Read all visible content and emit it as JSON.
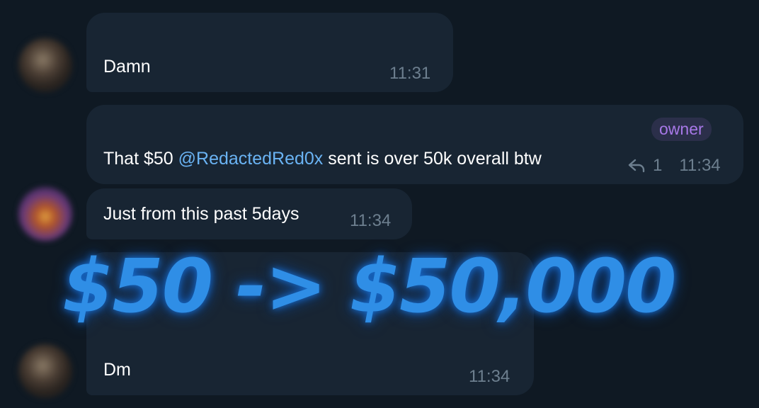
{
  "messages": [
    {
      "text": "Damn",
      "time": "11:31"
    },
    {
      "badge": "owner",
      "text_before": "That $50 ",
      "mention": "@RedactedRed0x",
      "text_after": " sent is over 50k overall btw",
      "reply_count": "1",
      "time": "11:34"
    },
    {
      "text": "Just from this past 5days",
      "time": "11:34"
    },
    {
      "text": "Dm",
      "time": "11:34"
    }
  ],
  "overlay": {
    "headline": "$50 -> $50,000"
  },
  "icons": {
    "reply": "reply-arrow-icon",
    "avatar": "user-avatar"
  },
  "colors": {
    "background": "#0f1923",
    "bubble": "#182533",
    "mention": "#6ab3f3",
    "badge_text": "#a878e8",
    "overlay": "#2f8ee6"
  }
}
